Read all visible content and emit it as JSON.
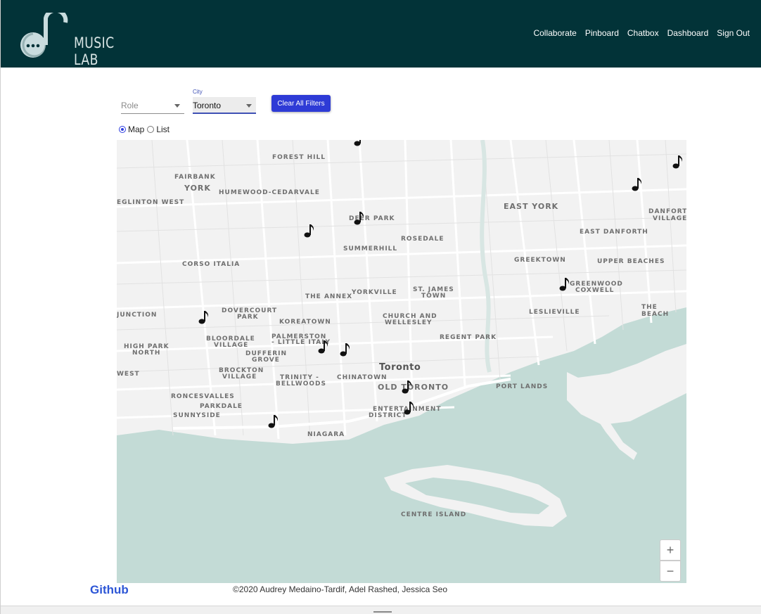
{
  "app": {
    "logo_text": "MUSIC LAB"
  },
  "nav": {
    "items": [
      "Collaborate",
      "Pinboard",
      "Chatbox",
      "Dashboard",
      "Sign Out"
    ]
  },
  "filters": {
    "role": {
      "placeholder": "Role",
      "value": ""
    },
    "city": {
      "label": "City",
      "value": "Toronto"
    },
    "clear_label": "Clear All Filters"
  },
  "view": {
    "map_label": "Map",
    "list_label": "List",
    "selected": "Map"
  },
  "map": {
    "labels": [
      "FOREST HILL",
      "FAIRBANK",
      "YORK",
      "HUMEWOOD-CEDARVALE",
      "EGLINTON WEST",
      "DEER PARK",
      "SUMMERHILL",
      "ROSEDALE",
      "EAST YORK",
      "DANFORTH",
      "VILLAGE",
      "EAST DANFORTH",
      "CORSO ITALIA",
      "GREEKTOWN",
      "UPPER BEACHES",
      "GREENWOOD",
      "COXWELL",
      "YORKVILLE",
      "ST. JAMES",
      "TOWN",
      "THE ANNEX",
      "DOVERCOURT",
      "PARK",
      "LESLIEVILLE",
      "THE BEACH",
      "JUNCTION",
      "CHURCH AND",
      "WELLESLEY",
      "KOREATOWN",
      "PALMERSTON",
      "- LITTLE ITALY",
      "HIGH PARK",
      "NORTH",
      "BLOORDALE",
      "VILLAGE",
      "REGENT PARK",
      "DUFFERIN",
      "GROVE",
      "Toronto",
      "BROCKTON",
      "VILLAGE",
      "TRINITY -",
      "BELLWOODS",
      "CHINATOWN",
      "OLD TORONTO",
      "PORT LANDS",
      "WEST",
      "RONCESVALLES",
      "PARKDALE",
      "ENTERTAINMENT",
      "DISTRICT",
      "SUNNYSIDE",
      "NIAGARA",
      "CENTRE ISLAND"
    ],
    "marker_icon": "music-note-icon",
    "marker_count": 13
  },
  "zoom": {
    "in_label": "+",
    "out_label": "−"
  },
  "footer": {
    "github": "Github",
    "copyright": "©2020 Audrey Medaino-Tardif, Adel Rashed, Jessica Seo"
  },
  "colors": {
    "header_bg": "#023338",
    "accent": "#2e3bd6",
    "water": "#c3dbd6",
    "land": "#f2f2f2"
  }
}
